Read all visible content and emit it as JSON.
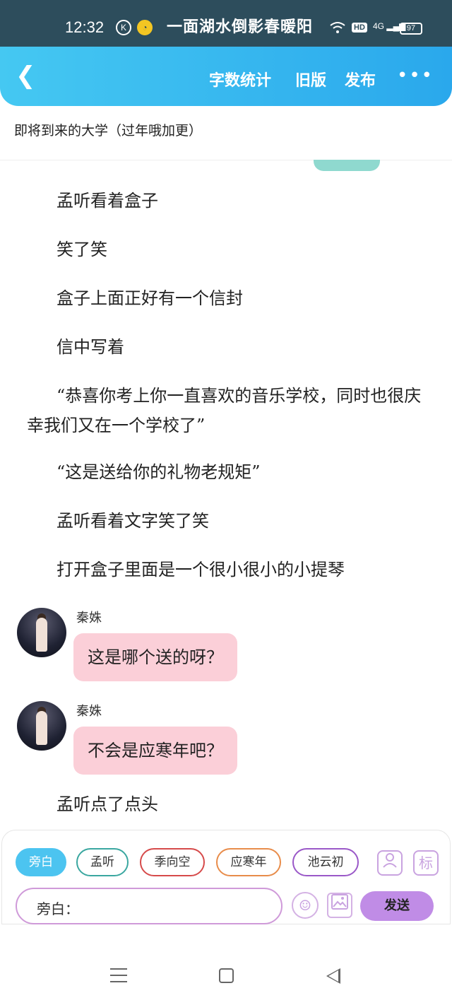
{
  "status_bar": {
    "time": "12:32",
    "icon_k": "K",
    "icon_app": "◔",
    "banner": "一面湖水倒影春暖阳",
    "network": "4G",
    "hd": "HD",
    "battery": "97"
  },
  "header": {
    "word_count": "字数统计",
    "old_version": "旧版",
    "publish": "发布",
    "more": "•••",
    "gradient_colors": [
      "#45c8f2",
      "#2aa8ec"
    ]
  },
  "chapter_title": "即将到来的大学（过年哦加更）",
  "story": {
    "p1": "孟听看着盒子",
    "p2": "笑了笑",
    "p3": "盒子上面正好有一个信封",
    "p4": "信中写着",
    "p5": "“恭喜你考上你一直喜欢的音乐学校，同时也很庆幸我们又在一个学校了”",
    "p6": "“这是送给你的礼物老规矩”",
    "p7": "孟听看着文字笑了笑",
    "p8": "打开盒子里面是一个很小很小的小提琴",
    "p9": "孟听点了点头"
  },
  "messages": [
    {
      "speaker": "秦姝",
      "text": "这是哪个送的呀？"
    },
    {
      "speaker": "秦姝",
      "text": "不会是应寒年吧？"
    }
  ],
  "bubble_color": "#fbcfd8",
  "roles": [
    {
      "label": "旁白",
      "selected": true,
      "color": "#4cc4f0"
    },
    {
      "label": "孟听",
      "selected": false,
      "color": "#3aa7a0"
    },
    {
      "label": "季向空",
      "selected": false,
      "color": "#d64a4a"
    },
    {
      "label": "应寒年",
      "selected": false,
      "color": "#e88c4a"
    },
    {
      "label": "池云初",
      "selected": false,
      "color": "#9a58c8"
    }
  ],
  "tools": {
    "person_icon": "person-icon",
    "mark_label": "标"
  },
  "input": {
    "label": "旁白：",
    "placeholder": ""
  },
  "send_label": "发送"
}
